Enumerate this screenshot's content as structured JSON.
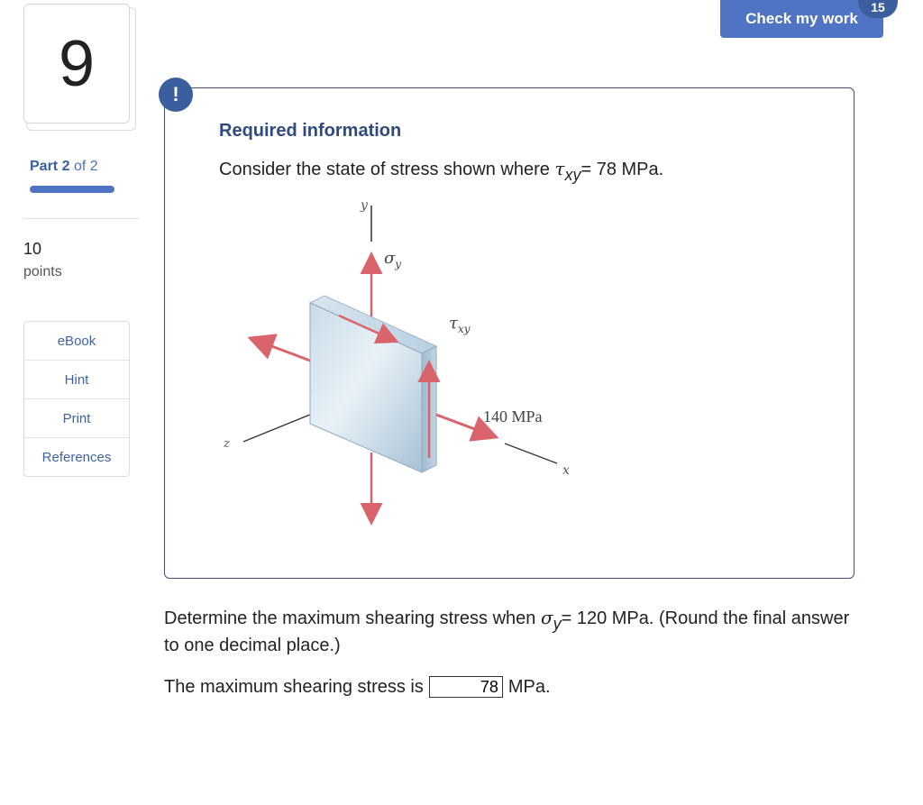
{
  "question": {
    "number": "9"
  },
  "part": {
    "label": "Part",
    "current": "2",
    "of_text": "of 2"
  },
  "points": {
    "value": "10",
    "label": "points"
  },
  "tools": [
    "eBook",
    "Hint",
    "Print",
    "References"
  ],
  "header": {
    "check_label": "Check my work",
    "badge": "15"
  },
  "info": {
    "alert": "!",
    "title": "Required information",
    "consider_prefix": "Consider the state of stress shown where ",
    "tau_symbol": "τ",
    "tau_sub": "xy",
    "consider_suffix": "= 78 MPa."
  },
  "figure": {
    "y_axis": "y",
    "z_axis": "z",
    "x_axis": "x",
    "sigma_label": "σ",
    "sigma_sub": "y",
    "tau_label": "τ",
    "tau_sub": "xy",
    "stress_label": "140 MPa"
  },
  "task": {
    "prefix": "Determine the maximum shearing stress when ",
    "sigma_symbol": "σ",
    "sigma_sub": "y",
    "suffix": "= 120 MPa. (Round the final answer to one decimal place.)"
  },
  "answer": {
    "prefix": "The maximum shearing stress is",
    "value": "78",
    "unit": "MPa."
  }
}
